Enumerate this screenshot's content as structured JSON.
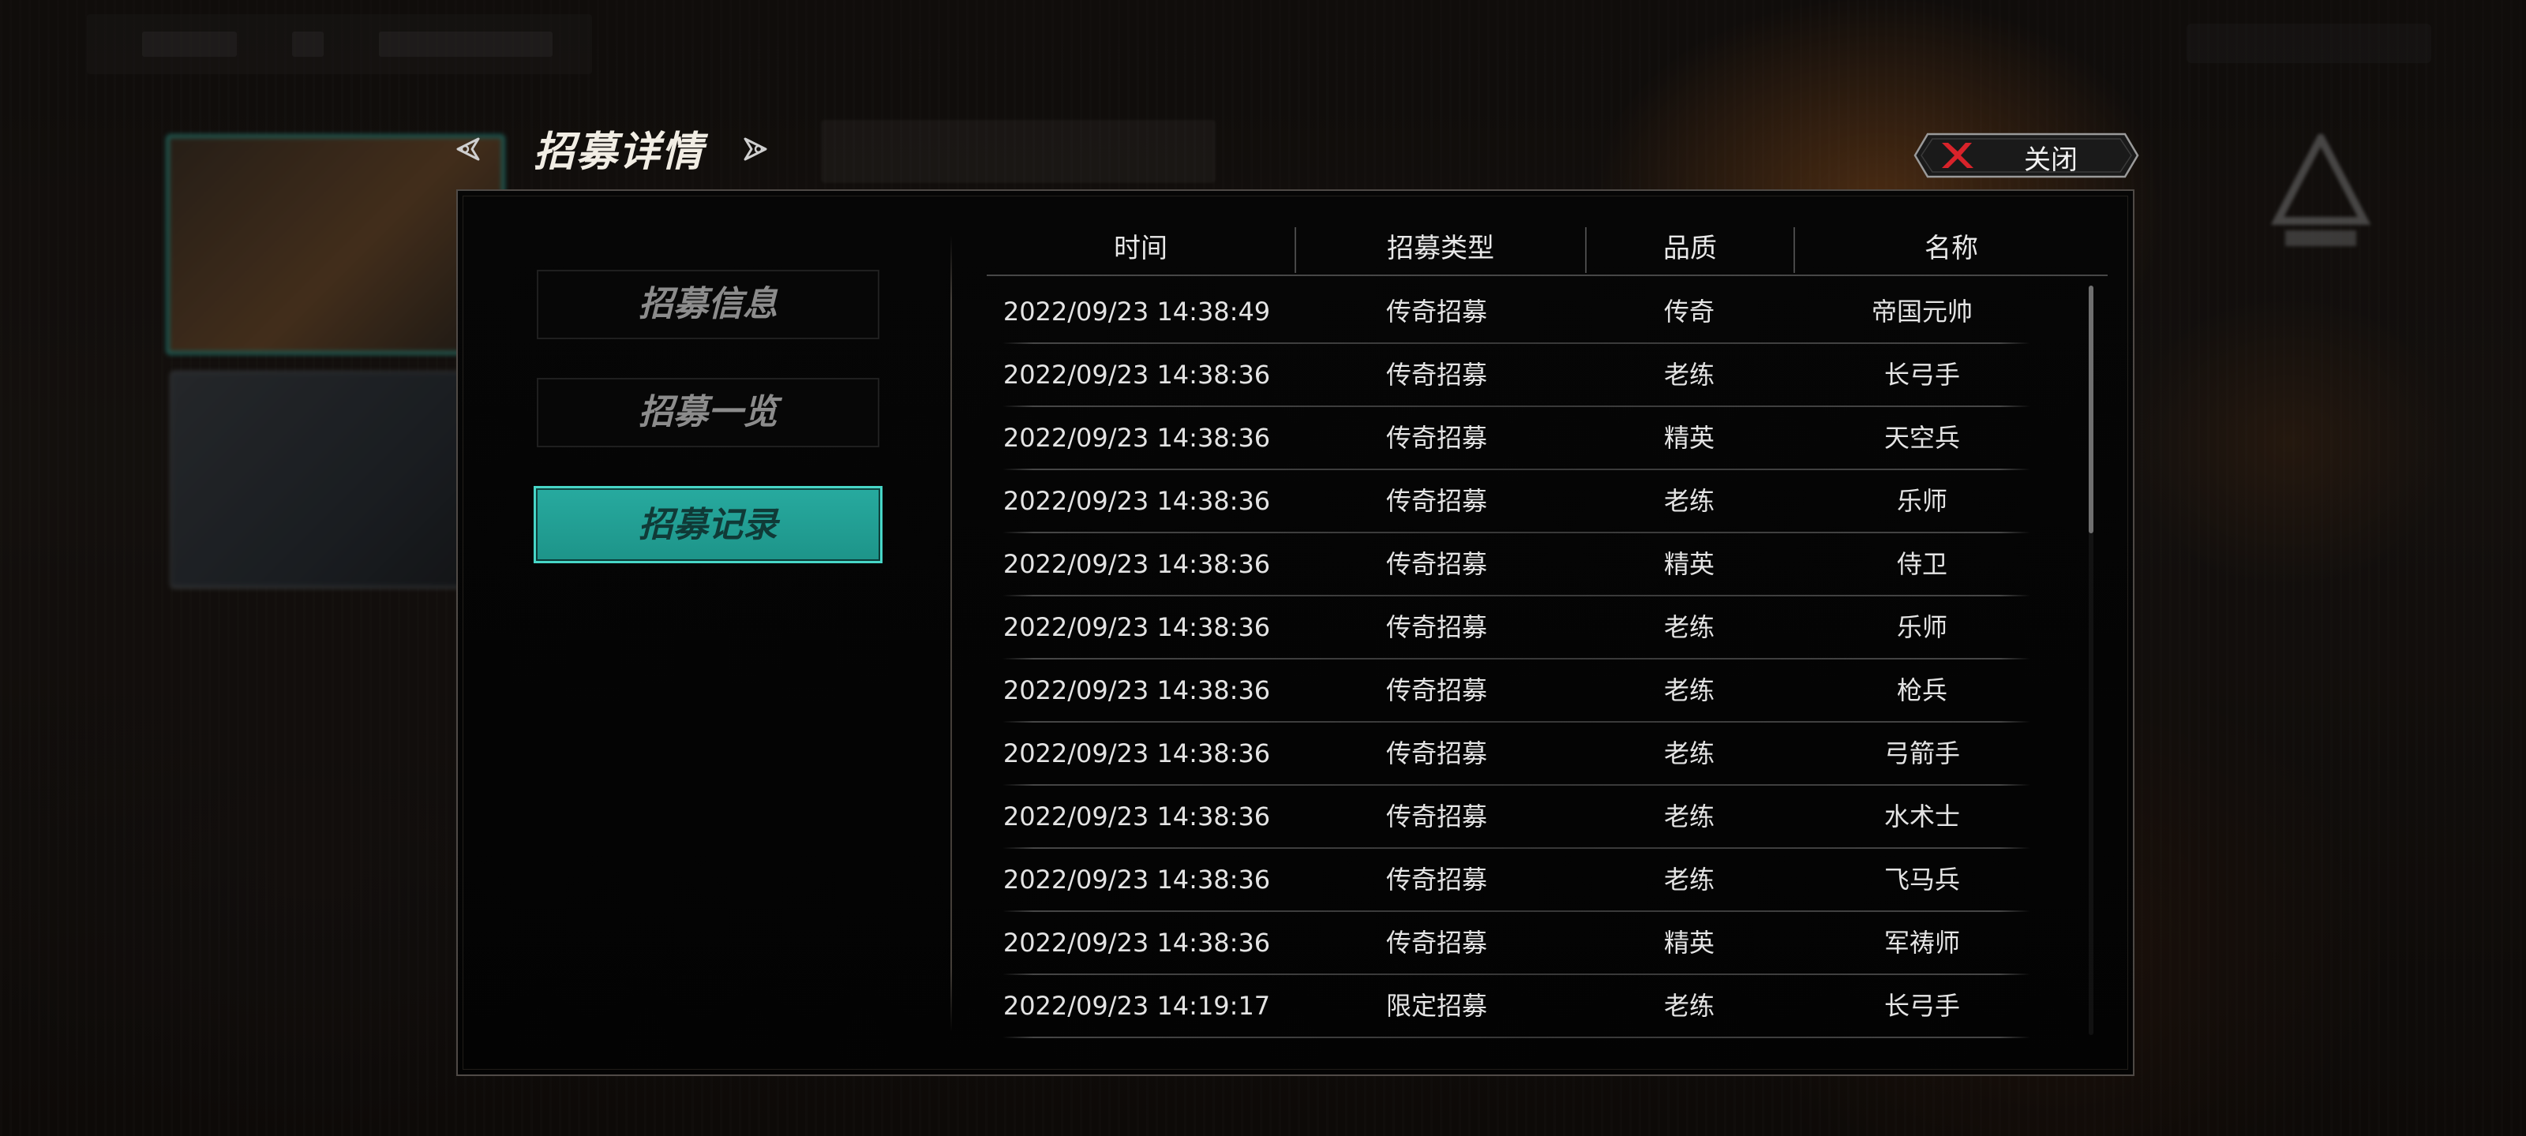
{
  "header": {
    "title": "招募详情",
    "close_label": "关闭",
    "prev_icon": "left-arrow-icon",
    "next_icon": "right-arrow-icon",
    "close_icon": "red-x-icon"
  },
  "menu": {
    "items": [
      {
        "label": "招募信息",
        "active": false
      },
      {
        "label": "招募一览",
        "active": false
      },
      {
        "label": "招募记录",
        "active": true
      }
    ]
  },
  "table": {
    "columns": [
      "时间",
      "招募类型",
      "品质",
      "名称"
    ],
    "rows": [
      {
        "time": "2022/09/23 14:38:49",
        "type": "传奇招募",
        "quality": "传奇",
        "name": "帝国元帅"
      },
      {
        "time": "2022/09/23 14:38:36",
        "type": "传奇招募",
        "quality": "老练",
        "name": "长弓手"
      },
      {
        "time": "2022/09/23 14:38:36",
        "type": "传奇招募",
        "quality": "精英",
        "name": "天空兵"
      },
      {
        "time": "2022/09/23 14:38:36",
        "type": "传奇招募",
        "quality": "老练",
        "name": "乐师"
      },
      {
        "time": "2022/09/23 14:38:36",
        "type": "传奇招募",
        "quality": "精英",
        "name": "侍卫"
      },
      {
        "time": "2022/09/23 14:38:36",
        "type": "传奇招募",
        "quality": "老练",
        "name": "乐师"
      },
      {
        "time": "2022/09/23 14:38:36",
        "type": "传奇招募",
        "quality": "老练",
        "name": "枪兵"
      },
      {
        "time": "2022/09/23 14:38:36",
        "type": "传奇招募",
        "quality": "老练",
        "name": "弓箭手"
      },
      {
        "time": "2022/09/23 14:38:36",
        "type": "传奇招募",
        "quality": "老练",
        "name": "水术士"
      },
      {
        "time": "2022/09/23 14:38:36",
        "type": "传奇招募",
        "quality": "老练",
        "name": "飞马兵"
      },
      {
        "time": "2022/09/23 14:38:36",
        "type": "传奇招募",
        "quality": "精英",
        "name": "军祷师"
      },
      {
        "time": "2022/09/23 14:19:17",
        "type": "限定招募",
        "quality": "老练",
        "name": "长弓手"
      }
    ]
  },
  "scroll": {
    "position": 0,
    "visible_fraction": 0.33
  },
  "colors": {
    "accent": "#23a096",
    "accent_border": "#47d6c7",
    "close_x": "#d8232a",
    "text": "#e4e4e4"
  }
}
